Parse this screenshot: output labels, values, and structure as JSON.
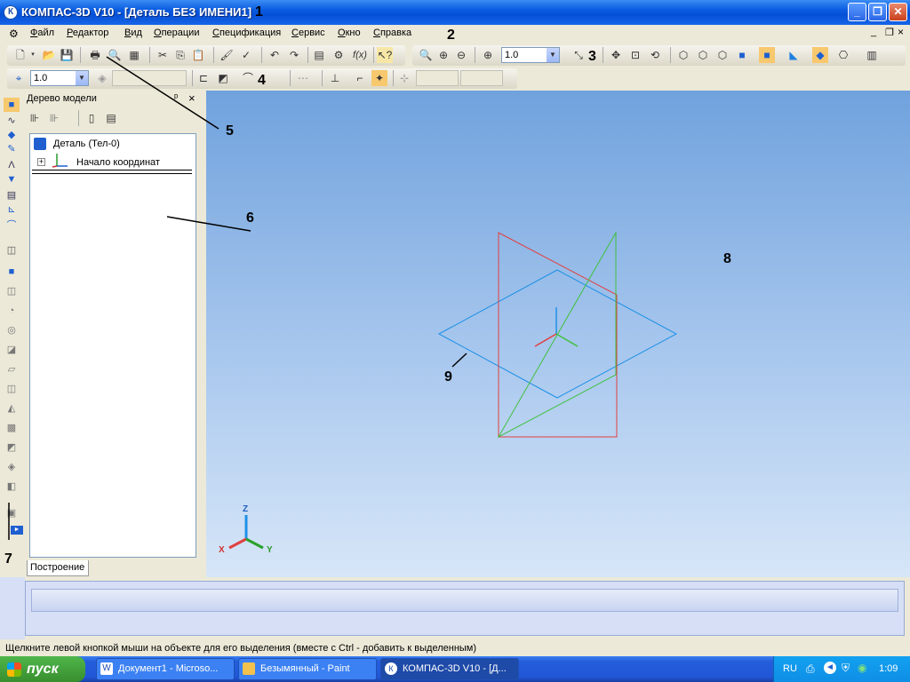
{
  "window": {
    "title": "КОМПАС-3D V10 - [Деталь БЕЗ ИМЕНИ1]",
    "app_icon": "К",
    "minimize": "_",
    "restore": "❐",
    "close": "✕"
  },
  "menu": {
    "items": [
      "Файл",
      "Редактор",
      "Вид",
      "Операции",
      "Спецификация",
      "Сервис",
      "Окно",
      "Справка"
    ],
    "doc_controls": [
      "_",
      "❐",
      "×"
    ]
  },
  "toolbar": {
    "zoom_value": "1.0",
    "step_value": "1.0",
    "fx_label": "f(x)"
  },
  "tree_panel": {
    "title": "Дерево модели",
    "pin": "ᵖ",
    "close": "×",
    "root_label": "Деталь (Тел-0)",
    "child_label": "Начало координат",
    "tab_label": "Построение"
  },
  "triad": {
    "x": "X",
    "y": "Y",
    "z": "Z"
  },
  "annotations": [
    "1",
    "2",
    "3",
    "4",
    "5",
    "6",
    "7",
    "8",
    "9"
  ],
  "status_text": "Щелкните левой кнопкой мыши на объекте для его выделения (вместе с Ctrl - добавить к выделенным)",
  "taskbar": {
    "start_label": "пуск",
    "tasks": [
      "Документ1 - Microso...",
      "Безымянный - Paint",
      "КОМПАС-3D V10 - [Д..."
    ],
    "lang": "RU",
    "clock": "1:09"
  },
  "colors": {
    "plane_xy": "#1e90e6",
    "plane_zx": "#e04040",
    "plane_zy": "#40c040"
  }
}
